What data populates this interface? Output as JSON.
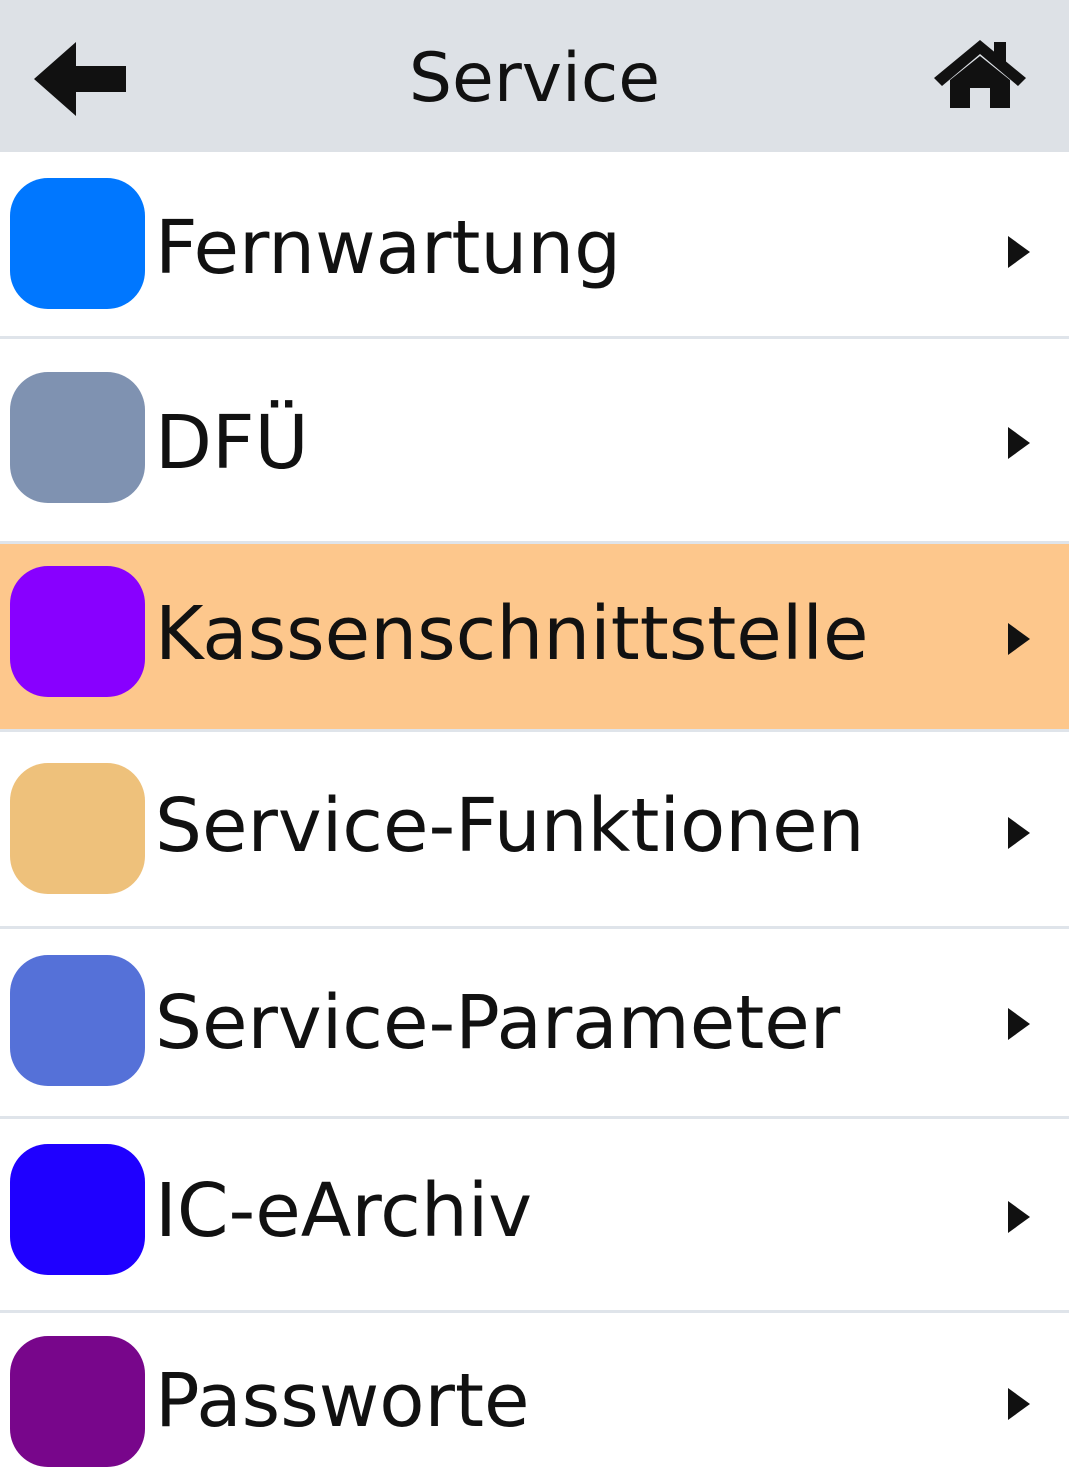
{
  "header": {
    "title": "Service",
    "back_icon": "arrow-left-icon",
    "home_icon": "home-icon"
  },
  "items": [
    {
      "label": "Fernwartung",
      "color": "#0077ff",
      "selected": false
    },
    {
      "label": "DFÜ",
      "color": "#7f92b1",
      "selected": false
    },
    {
      "label": "Kassenschnittstelle",
      "color": "#8800ff",
      "selected": true
    },
    {
      "label": "Service-Funktionen",
      "color": "#eec17b",
      "selected": false
    },
    {
      "label": "Service-Parameter",
      "color": "#5571d8",
      "selected": false
    },
    {
      "label": "IC-eArchiv",
      "color": "#1f00ff",
      "selected": false
    },
    {
      "label": "Passworte",
      "color": "#78068b",
      "selected": false
    }
  ],
  "colors": {
    "header_bg": "#dde1e6",
    "selected_bg": "#fdc78c"
  }
}
